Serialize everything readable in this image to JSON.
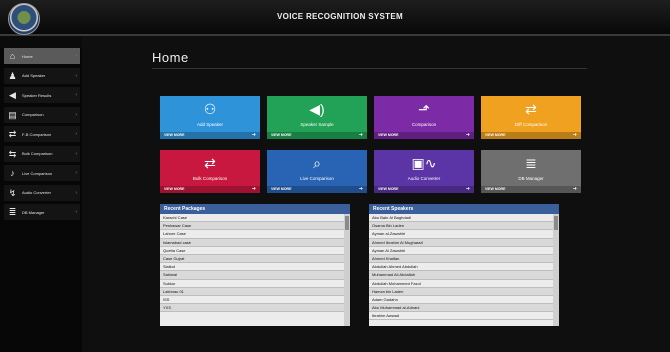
{
  "app": {
    "title": "VOICE RECOGNITION SYSTEM"
  },
  "sidebar": {
    "items": [
      {
        "label": "Home",
        "icon": "home-icon",
        "glyph": "⌂"
      },
      {
        "label": "Add Speaker",
        "icon": "user-icon",
        "glyph": "♟"
      },
      {
        "label": "Speaker Results",
        "icon": "speaker-icon",
        "glyph": "◀"
      },
      {
        "label": "Comparison",
        "icon": "chart-icon",
        "glyph": "▤"
      },
      {
        "label": "F-B Comparison",
        "icon": "compare-icon",
        "glyph": "⇄"
      },
      {
        "label": "Bulk Comparison",
        "icon": "bulk-icon",
        "glyph": "⇆"
      },
      {
        "label": "Live Comparison",
        "icon": "microphone-icon",
        "glyph": "♪"
      },
      {
        "label": "Audio Converter",
        "icon": "audio-icon",
        "glyph": "↯"
      },
      {
        "label": "DB Manager",
        "icon": "database-icon",
        "glyph": "≣"
      }
    ]
  },
  "main": {
    "title": "Home",
    "tiles": [
      {
        "label": "Add Speaker",
        "more": "VIEW MORE",
        "color": "#2e93d9",
        "icon": "add-user-icon",
        "glyph": "⚇"
      },
      {
        "label": "Speaker Sample",
        "more": "VIEW MORE",
        "color": "#21a256",
        "icon": "speaker-icon",
        "glyph": "◀)"
      },
      {
        "label": "Comparison",
        "more": "VIEW MORE",
        "color": "#7d2aa6",
        "icon": "line-chart-icon",
        "glyph": "⬏"
      },
      {
        "label": "Diff Comparison",
        "more": "VIEW MORE",
        "color": "#f0a11f",
        "icon": "diff-icon",
        "glyph": "⇄"
      },
      {
        "label": "Bulk Comparison",
        "more": "VIEW MORE",
        "color": "#c9183f",
        "icon": "bulk-compare-icon",
        "glyph": "⇄"
      },
      {
        "label": "Live Comparison",
        "more": "VIEW MORE",
        "color": "#2863b4",
        "icon": "search-icon",
        "glyph": "⌕"
      },
      {
        "label": "Audio Converter",
        "more": "VIEW MORE",
        "color": "#5b35a6",
        "icon": "audio-wave-icon",
        "glyph": "▣∿"
      },
      {
        "label": "DB Manager",
        "more": "VIEW MORE",
        "color": "#6f6f6f",
        "icon": "database-icon",
        "glyph": "≣"
      }
    ],
    "recent_packages": {
      "header": "Recent Packages",
      "items": [
        "Karachi Case",
        "Peshawar Case",
        "Lahore Case",
        "Islamabad case",
        "Quetta Case",
        "Case Gujrat",
        "Sialkot",
        "Sahiwal",
        "Sukkur",
        "Lakhnau 01",
        "ISS",
        "YXS"
      ]
    },
    "recent_speakers": {
      "header": "Recent Speakers",
      "items": [
        "Abu Bakr Al Baghdadi",
        "Osama Bin Laden",
        "Ayman al-Zawahiri",
        "Ahmed Ibrahim Al Mughassil",
        "Ayman Al Zawahiri",
        "Ahmed Khalfan",
        "Abdullah Ahmed Abdullah",
        "Muhammad Ali Abdallah",
        "Abdullah Mohammed Fazul",
        "Hamza bin Laden",
        "Adam Gadahn",
        "Abu Muhammad al-Adnani",
        "Ibrahim Awwad"
      ]
    }
  }
}
